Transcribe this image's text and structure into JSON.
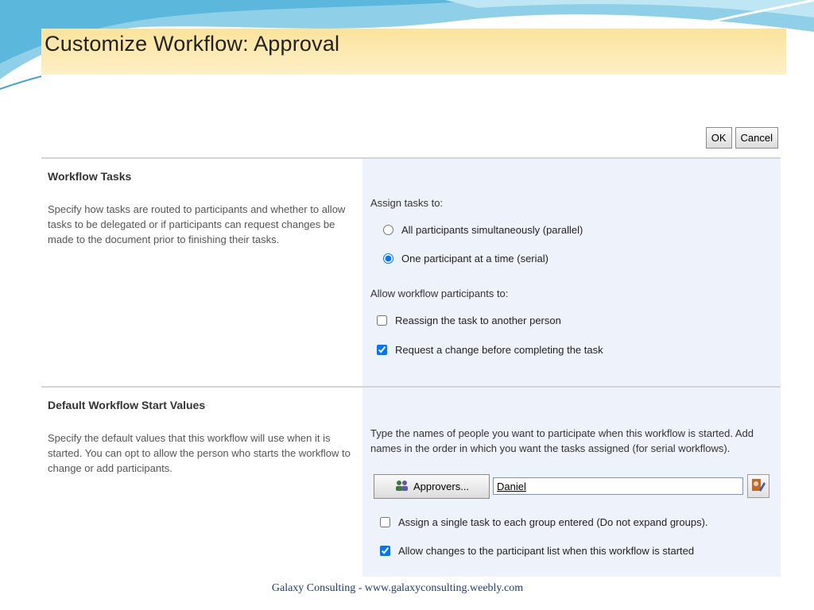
{
  "window": {
    "title": "Customize Workflow: Approval"
  },
  "toolbar": {
    "ok_label": "OK",
    "cancel_label": "Cancel"
  },
  "workflow_tasks": {
    "title": "Workflow Tasks",
    "description": "Specify how tasks are routed to participants and whether to allow tasks to be delegated or if participants can request changes be made to the document prior to finishing their tasks.",
    "assign_label": "Assign tasks to:",
    "assign_options": [
      {
        "label": "All participants simultaneously (parallel)",
        "selected": false
      },
      {
        "label": "One participant at a time (serial)",
        "selected": true
      }
    ],
    "allow_label": "Allow workflow participants to:",
    "allow_options": [
      {
        "label": "Reassign the task to another person",
        "checked": false
      },
      {
        "label": "Request a change before completing the task",
        "checked": true
      }
    ]
  },
  "start_values": {
    "title": "Default Workflow Start Values",
    "description": "Specify the default values that this workflow will use when it is started. You can opt to allow the person who starts the workflow to change or add participants.",
    "prompt": "Type the names of people you want to participate when this workflow is started.  Add names in the order in which you want the tasks assigned (for serial workflows).",
    "approvers_label": "Approvers...",
    "approvers_value": "Daniel",
    "options": [
      {
        "label": "Assign a single task to each group entered (Do not expand groups).",
        "checked": false
      },
      {
        "label": "Allow changes to the participant list when this workflow is started",
        "checked": true
      }
    ]
  },
  "footer": {
    "text": "Galaxy Consulting - www.galaxyconsulting.weebly.com"
  },
  "colors": {
    "header_bg": "#fbe39b",
    "panel_bg": "#eef3fb",
    "footer_text": "#1f3a80"
  }
}
